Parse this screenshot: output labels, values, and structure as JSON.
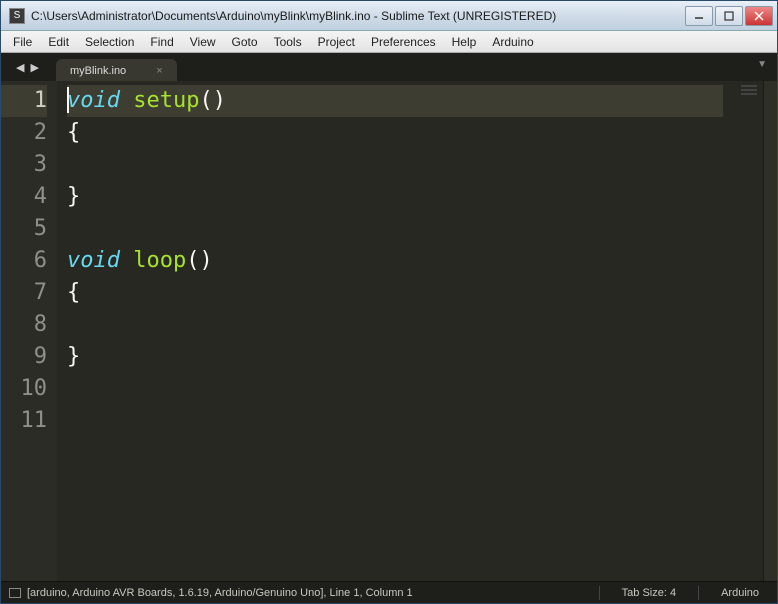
{
  "window": {
    "title": "C:\\Users\\Administrator\\Documents\\Arduino\\myBlink\\myBlink.ino - Sublime Text (UNREGISTERED)"
  },
  "menu": {
    "items": [
      "File",
      "Edit",
      "Selection",
      "Find",
      "View",
      "Goto",
      "Tools",
      "Project",
      "Preferences",
      "Help",
      "Arduino"
    ]
  },
  "tabs": {
    "active": {
      "name": "myBlink.ino"
    }
  },
  "editor": {
    "line_count": 11,
    "active_line": 1,
    "lines": [
      {
        "tokens": [
          {
            "t": "void",
            "c": "kw-type"
          },
          {
            "t": " ",
            "c": "punct"
          },
          {
            "t": "setup",
            "c": "fn-name"
          },
          {
            "t": "()",
            "c": "punct"
          }
        ]
      },
      {
        "tokens": [
          {
            "t": "{",
            "c": "brace"
          }
        ]
      },
      {
        "tokens": []
      },
      {
        "tokens": [
          {
            "t": "}",
            "c": "brace"
          }
        ]
      },
      {
        "tokens": []
      },
      {
        "tokens": [
          {
            "t": "void",
            "c": "kw-type"
          },
          {
            "t": " ",
            "c": "punct"
          },
          {
            "t": "loop",
            "c": "fn-name"
          },
          {
            "t": "()",
            "c": "punct"
          }
        ]
      },
      {
        "tokens": [
          {
            "t": "{",
            "c": "brace"
          }
        ]
      },
      {
        "tokens": []
      },
      {
        "tokens": [
          {
            "t": "}",
            "c": "brace"
          }
        ]
      },
      {
        "tokens": []
      },
      {
        "tokens": []
      }
    ]
  },
  "status": {
    "left": "[arduino, Arduino AVR Boards, 1.6.19, Arduino/Genuino Uno], Line 1, Column 1",
    "tab_size": "Tab Size: 4",
    "syntax": "Arduino"
  }
}
